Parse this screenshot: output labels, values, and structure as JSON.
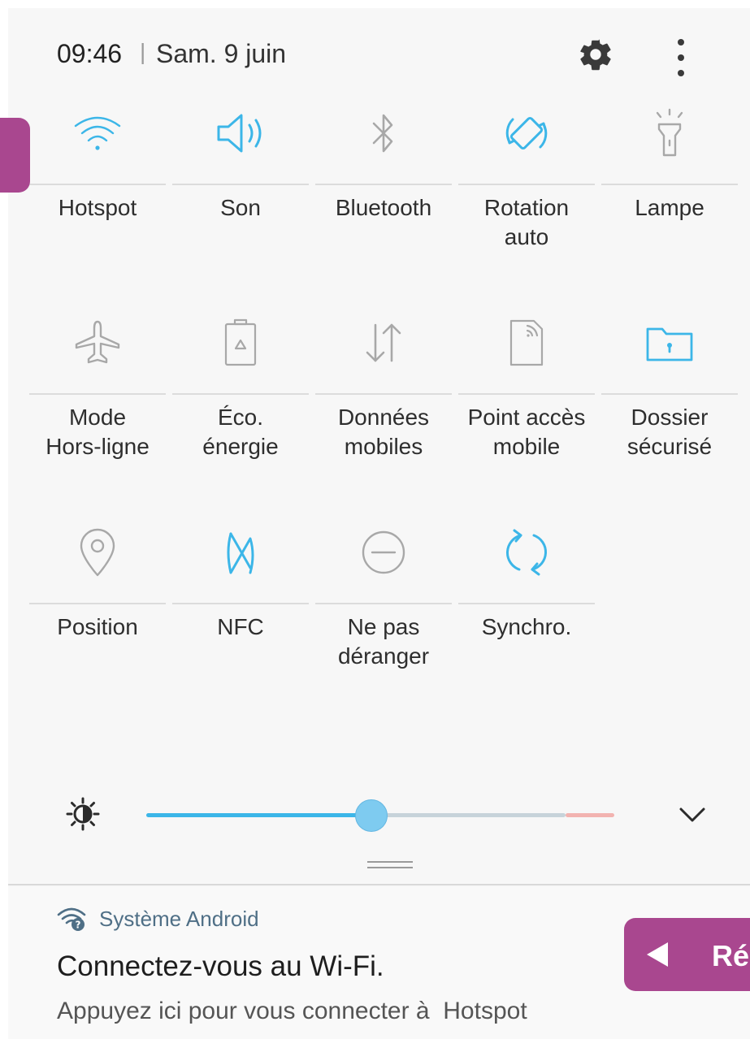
{
  "status": {
    "time": "09:46",
    "separator": "|",
    "date": "Sam. 9 juin"
  },
  "header_icons": [
    "gear-icon",
    "more-vertical-icon"
  ],
  "tiles": [
    {
      "label": "Hotspot",
      "icon": "wifi-icon",
      "active": true
    },
    {
      "label": "Son",
      "icon": "volume-icon",
      "active": true
    },
    {
      "label": "Bluetooth",
      "icon": "bluetooth-icon",
      "active": false
    },
    {
      "label": "Rotation\nauto",
      "icon": "auto-rotate-icon",
      "active": true
    },
    {
      "label": "Lampe",
      "icon": "flashlight-icon",
      "active": false
    },
    {
      "label": "Mode\nHors-ligne",
      "icon": "airplane-icon",
      "active": false
    },
    {
      "label": "Éco.\nénergie",
      "icon": "battery-saver-icon",
      "active": false
    },
    {
      "label": "Données\nmobiles",
      "icon": "mobile-data-icon",
      "active": false
    },
    {
      "label": "Point accès\nmobile",
      "icon": "mobile-hotspot-icon",
      "active": false
    },
    {
      "label": "Dossier\nsécurisé",
      "icon": "secure-folder-icon",
      "active": true
    },
    {
      "label": "Position",
      "icon": "location-icon",
      "active": false
    },
    {
      "label": "NFC",
      "icon": "nfc-icon",
      "active": true
    },
    {
      "label": "Ne pas\ndéranger",
      "icon": "do-not-disturb-icon",
      "active": false
    },
    {
      "label": "Synchro.",
      "icon": "sync-icon",
      "active": true
    }
  ],
  "brightness": {
    "level": 0.48
  },
  "notification": {
    "app": "Système Android",
    "title": "Connectez-vous au Wi-Fi.",
    "body": "Appuyez ici pour vous connecter à  Hotspot"
  },
  "overlay": {
    "back_label": "Ré"
  },
  "colors": {
    "active": "#3cb6e8",
    "inactive": "#a8a8a8",
    "overlay": "#a9478f",
    "panel": "#f7f7f7"
  }
}
